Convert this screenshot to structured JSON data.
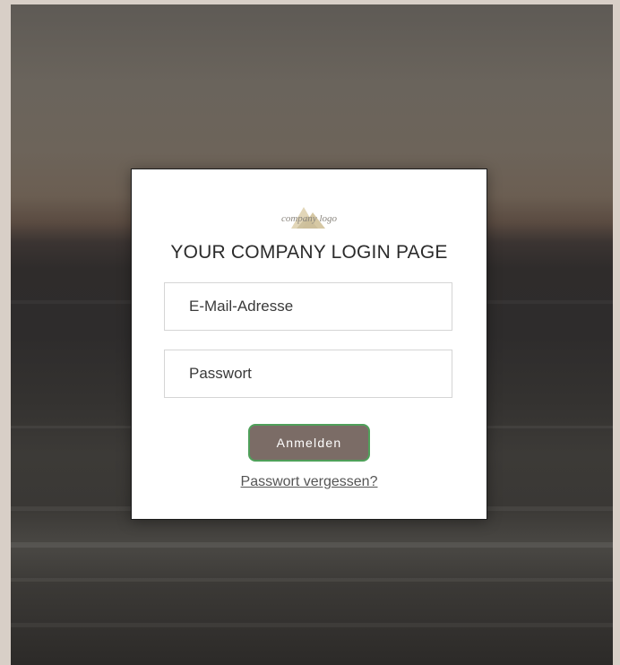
{
  "login": {
    "logo_text": "company logo",
    "title": "YOUR COMPANY LOGIN PAGE",
    "email_placeholder": "E-Mail-Adresse",
    "password_placeholder": "Passwort",
    "submit_label": "Anmelden",
    "forgot_link": "Passwort vergessen?"
  },
  "colors": {
    "page_border": "#d8cfc7",
    "button_fill": "#7b6c66",
    "button_border": "#4fa05a",
    "card_background": "#ffffff"
  }
}
